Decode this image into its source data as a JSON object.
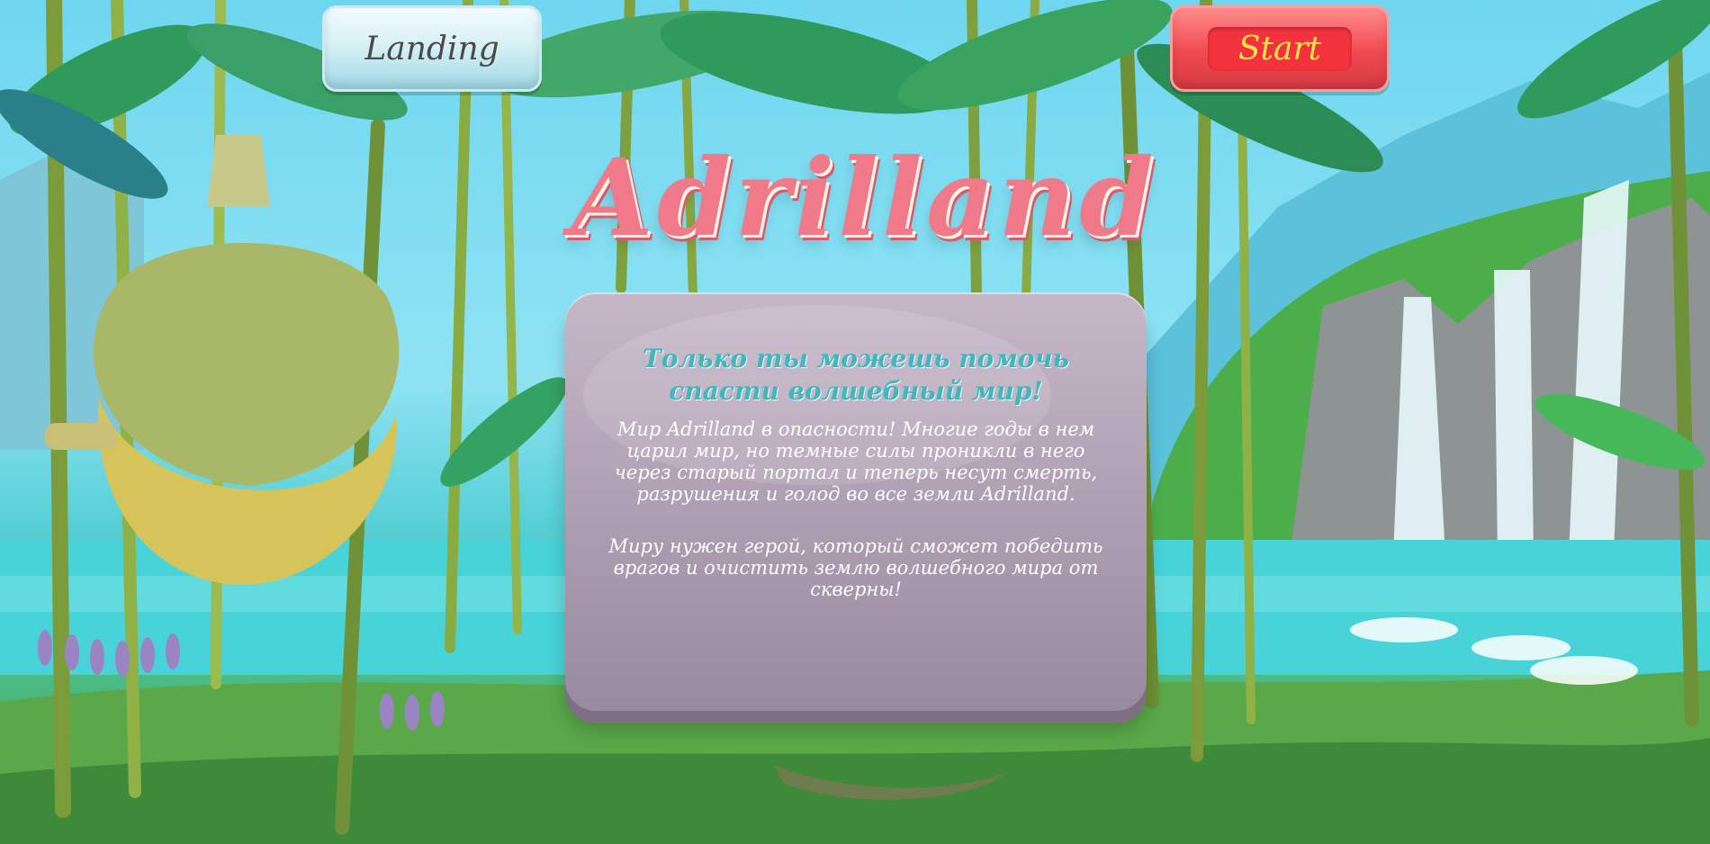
{
  "nav": {
    "landing_label": "Landing",
    "start_label": "Start"
  },
  "game": {
    "title": "Adrilland"
  },
  "panel": {
    "heading": "Только ты можешь помочь спасти волшебный мир!",
    "paragraph1": "Мир Adrilland в опасности! Многие годы в нем царил мир, но темные силы проникли в него через старый портал и теперь несут смерть, разрушения и голод во все земли Adrilland.",
    "paragraph2": "Миру нужен герой, который сможет победить врагов и очистить землю волшебного мира от скверны!"
  },
  "colors": {
    "title": "#f07a8a",
    "heading": "#3fb7bd",
    "start_text": "#ffe54a",
    "start_bg": "#f2323c",
    "panel": "#ad9db1"
  }
}
